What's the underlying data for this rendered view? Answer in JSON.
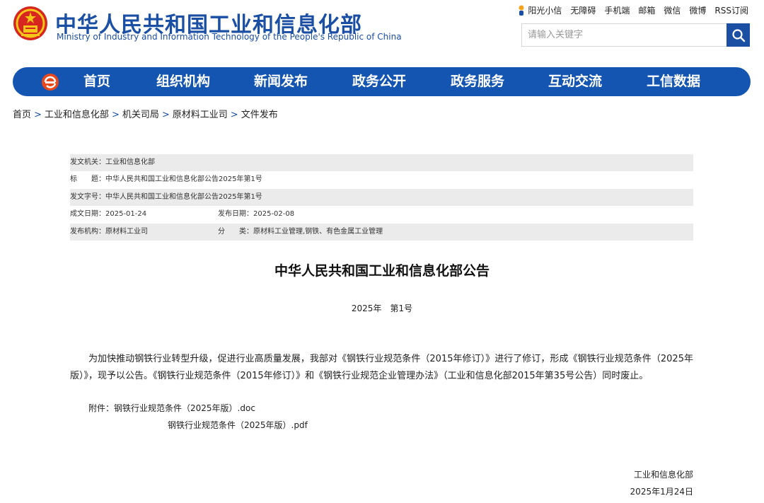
{
  "header": {
    "title_cn": "中华人民共和国工业和信息化部",
    "title_en": "Ministry of Industry and Information Technology of the People's Republic of China",
    "toplinks": [
      "阳光小信",
      "无障碍",
      "手机端",
      "邮箱",
      "微信",
      "微博",
      "RSS订阅"
    ],
    "search_placeholder": "请输入关键字"
  },
  "nav": {
    "items": [
      "首页",
      "组织机构",
      "新闻发布",
      "政务公开",
      "政务服务",
      "互动交流",
      "工信数据"
    ]
  },
  "breadcrumb": [
    "首页",
    "工业和信息化部",
    "机关司局",
    "原材料工业司",
    "文件发布"
  ],
  "meta": {
    "issuer": "发文机关：工业和信息化部",
    "title": "标　　题：中华人民共和国工业和信息化部公告2025年第1号",
    "doc_no": "发文字号：中华人民共和国工业和信息化部公告2025年第1号",
    "written_date": "成文日期：2025-01-24",
    "publish_date": "发布日期：2025-02-08",
    "publisher": "发布机构：原材料工业司",
    "category": "分　　类：原材料工业管理,钢铁、有色金属工业管理"
  },
  "article": {
    "title": "中华人民共和国工业和信息化部公告",
    "issue": "2025年　第1号",
    "paragraph": "为加快推动钢铁行业转型升级，促进行业高质量发展，我部对《钢铁行业规范条件（2015年修订）》进行了修订，形成《钢铁行业规范条件（2025年版）》，现予以公告。《钢铁行业规范条件（2015年修订）》和《钢铁行业规范企业管理办法》（工业和信息化部2015年第35号公告）同时废止。",
    "attachment_label": "附件：",
    "attachment_1": "钢铁行业规范条件（2025年版）.doc",
    "attachment_2": "钢铁行业规范条件（2025年版）.pdf",
    "signature": "工业和信息化部",
    "date": "2025年1月24日"
  },
  "colors": {
    "brand_blue": "#1555b2",
    "row_shade": "#ebebeb"
  }
}
